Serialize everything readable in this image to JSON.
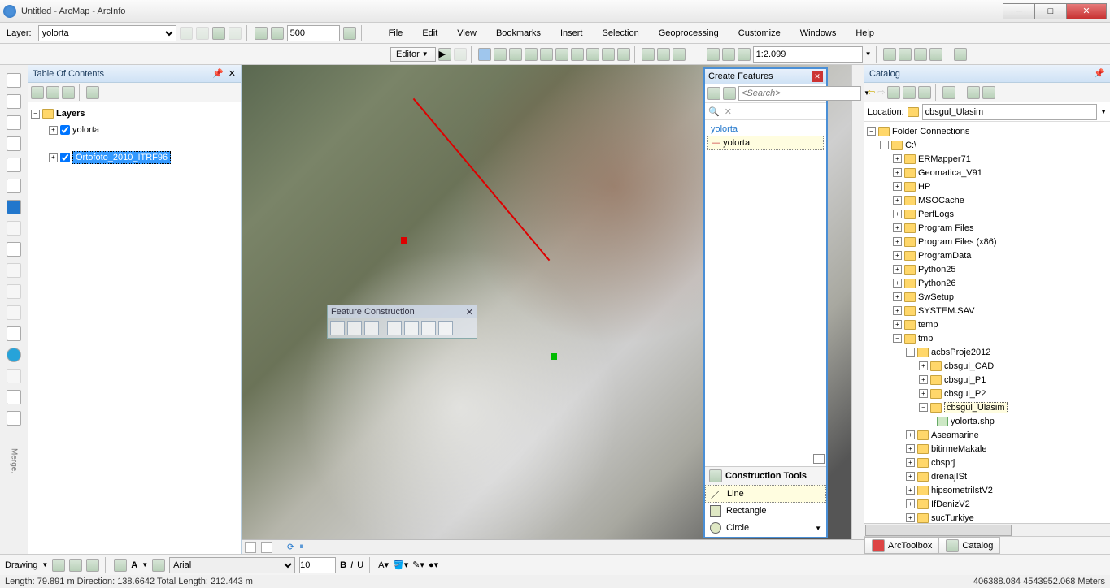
{
  "title": "Untitled - ArcMap - ArcInfo",
  "layer_label": "Layer:",
  "layer_selected": "yolorta",
  "scale_num": "500",
  "menus": [
    "File",
    "Edit",
    "View",
    "Bookmarks",
    "Insert",
    "Selection",
    "Geoprocessing",
    "Customize",
    "Windows",
    "Help"
  ],
  "editor_label": "Editor",
  "map_scale": "1:2.099",
  "toc": {
    "title": "Table Of Contents",
    "root": "Layers",
    "items": [
      "yolorta",
      "Ortofoto_2010_ITRF96"
    ]
  },
  "feature_construction": "Feature Construction",
  "create_features": {
    "title": "Create Features",
    "search_placeholder": "<Search>",
    "group": "yolorta",
    "item": "yolorta",
    "tools_title": "Construction Tools",
    "tools": [
      "Line",
      "Rectangle",
      "Circle"
    ]
  },
  "catalog": {
    "title": "Catalog",
    "location_label": "Location:",
    "location": "cbsgul_Ulasim",
    "root": "Folder Connections",
    "drive": "C:\\",
    "folders": [
      "ERMapper71",
      "Geomatica_V91",
      "HP",
      "MSOCache",
      "PerfLogs",
      "Program Files",
      "Program Files (x86)",
      "ProgramData",
      "Python25",
      "Python26",
      "SwSetup",
      "SYSTEM.SAV",
      "temp"
    ],
    "tmp": "tmp",
    "proj": "acbsProje2012",
    "projsub": [
      "cbsgul_CAD",
      "cbsgul_P1",
      "cbsgul_P2",
      "cbsgul_Ulasim"
    ],
    "shapefile": "yolorta.shp",
    "tail": [
      "Aseamarine",
      "bitirmeMakale",
      "cbsprj",
      "drenajISt",
      "hipsometriIstV2",
      "IfDenizV2",
      "sucTurkiye"
    ],
    "tabs": [
      "ArcToolbox",
      "Catalog"
    ]
  },
  "drawing_label": "Drawing",
  "font": "Arial",
  "font_size": "10",
  "status_left": "Length: 79.891 m  Direction: 138.6642  Total Length: 212.443 m",
  "status_right": "406388.084 4543952.068 Meters",
  "vtext": "Merge."
}
